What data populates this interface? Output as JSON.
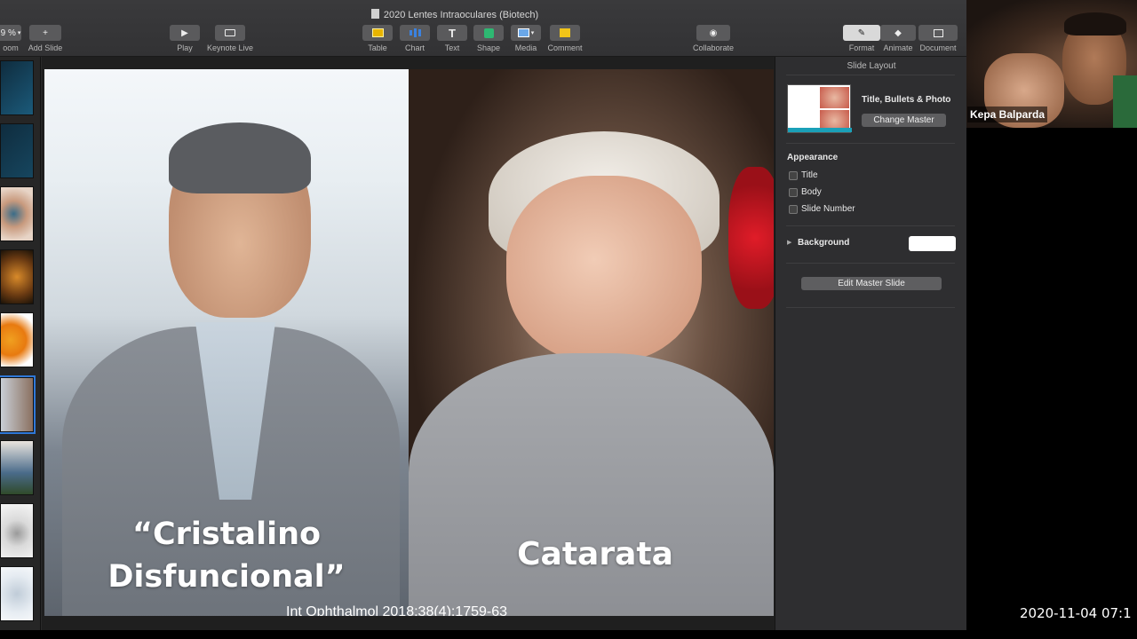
{
  "window": {
    "title": "2020 Lentes Intraoculares (Biotech)"
  },
  "toolbar": {
    "zoom_label": "oom",
    "zoom_value": "9 %",
    "add_slide": "Add Slide",
    "play": "Play",
    "keynote_live": "Keynote Live",
    "table": "Table",
    "chart": "Chart",
    "text": "Text",
    "shape": "Shape",
    "media": "Media",
    "comment": "Comment",
    "collaborate": "Collaborate",
    "format": "Format",
    "animate": "Animate",
    "document": "Document"
  },
  "slide": {
    "caption_left": "“Cristalino Disfuncional”",
    "caption_right": "Catarata",
    "citation": "Int Ophthalmol 2018;38(4):1759-63"
  },
  "inspector": {
    "header": "Slide Layout",
    "layout_name": "Title, Bullets & Photo",
    "change_master": "Change Master",
    "appearance": "Appearance",
    "opt_title": "Title",
    "opt_body": "Body",
    "opt_slide_number": "Slide Number",
    "background": "Background",
    "background_color": "#ffffff",
    "edit_master": "Edit Master Slide"
  },
  "webcam": {
    "name": "Kepa Balparda"
  },
  "timestamp": "2020-11-04  07:1",
  "colors": {
    "accent": "#2f78d8",
    "chart_btn": "#3b82e0",
    "shape_btn": "#2eb872",
    "table_btn": "#e8b400",
    "comment_btn": "#f0c419"
  }
}
